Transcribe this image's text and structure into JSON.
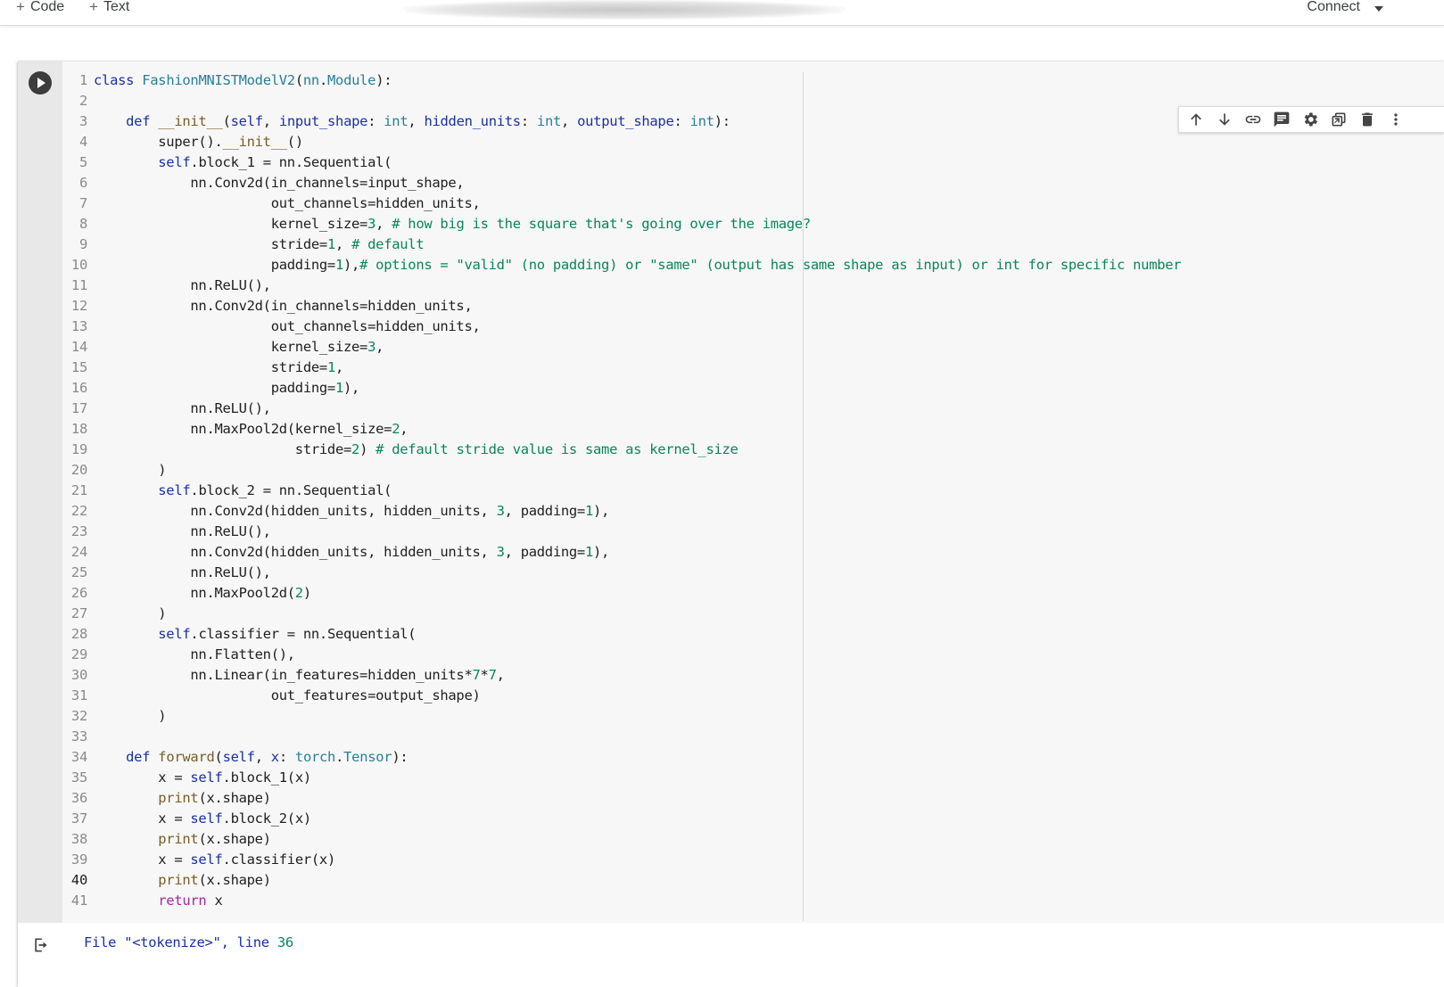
{
  "toolbar": {
    "code_label": "Code",
    "text_label": "Text",
    "connect_label": "Connect"
  },
  "cell": {
    "line_count": 41,
    "active_line": 40
  },
  "output": {
    "file_label": "File",
    "file_name": "\"<tokenize>\"",
    "line_label": "line",
    "line_number": "36"
  }
}
